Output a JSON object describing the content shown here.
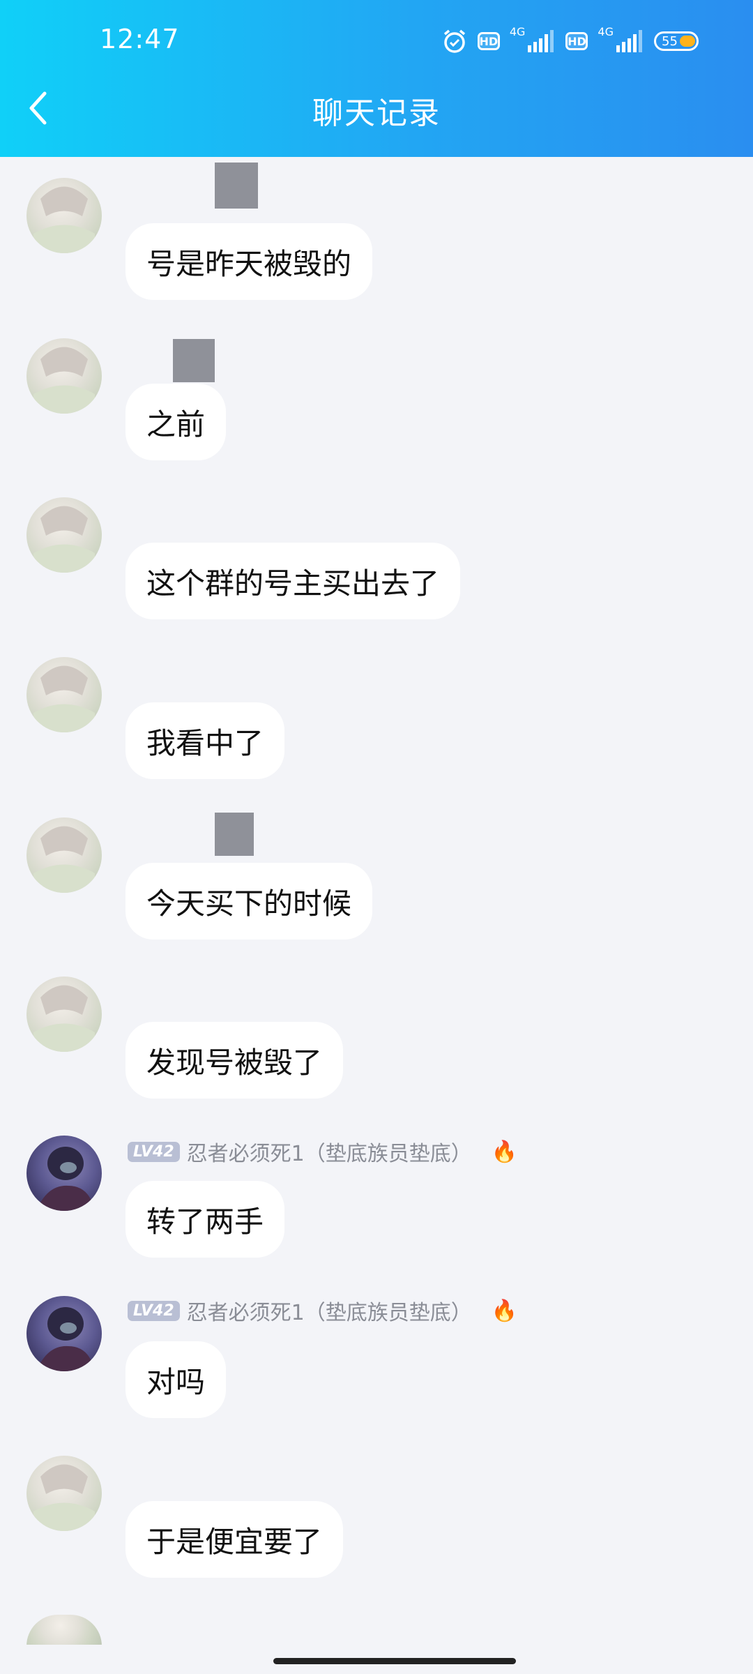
{
  "status_bar": {
    "time": "12:47",
    "hd": "HD",
    "network": "4G",
    "battery": "55"
  },
  "header": {
    "title": "聊天记录"
  },
  "messages": [
    {
      "text": "号是昨天被毁的"
    },
    {
      "text": "之前"
    },
    {
      "text": "这个群的号主买出去了"
    },
    {
      "text": "我看中了"
    },
    {
      "text": "今天买下的时候"
    },
    {
      "text": "发现号被毁了"
    },
    {
      "text": "转了两手",
      "level": "LV42",
      "nickname": "忍者必须死1（垫底族员垫底）"
    },
    {
      "text": "对吗",
      "level": "LV42",
      "nickname": "忍者必须死1（垫底族员垫底）"
    },
    {
      "text": "于是便宜要了"
    }
  ],
  "colors": {
    "header_start": "#10d0f8",
    "header_end": "#2a8ef0",
    "background": "#f3f4f8",
    "bubble": "#ffffff"
  }
}
